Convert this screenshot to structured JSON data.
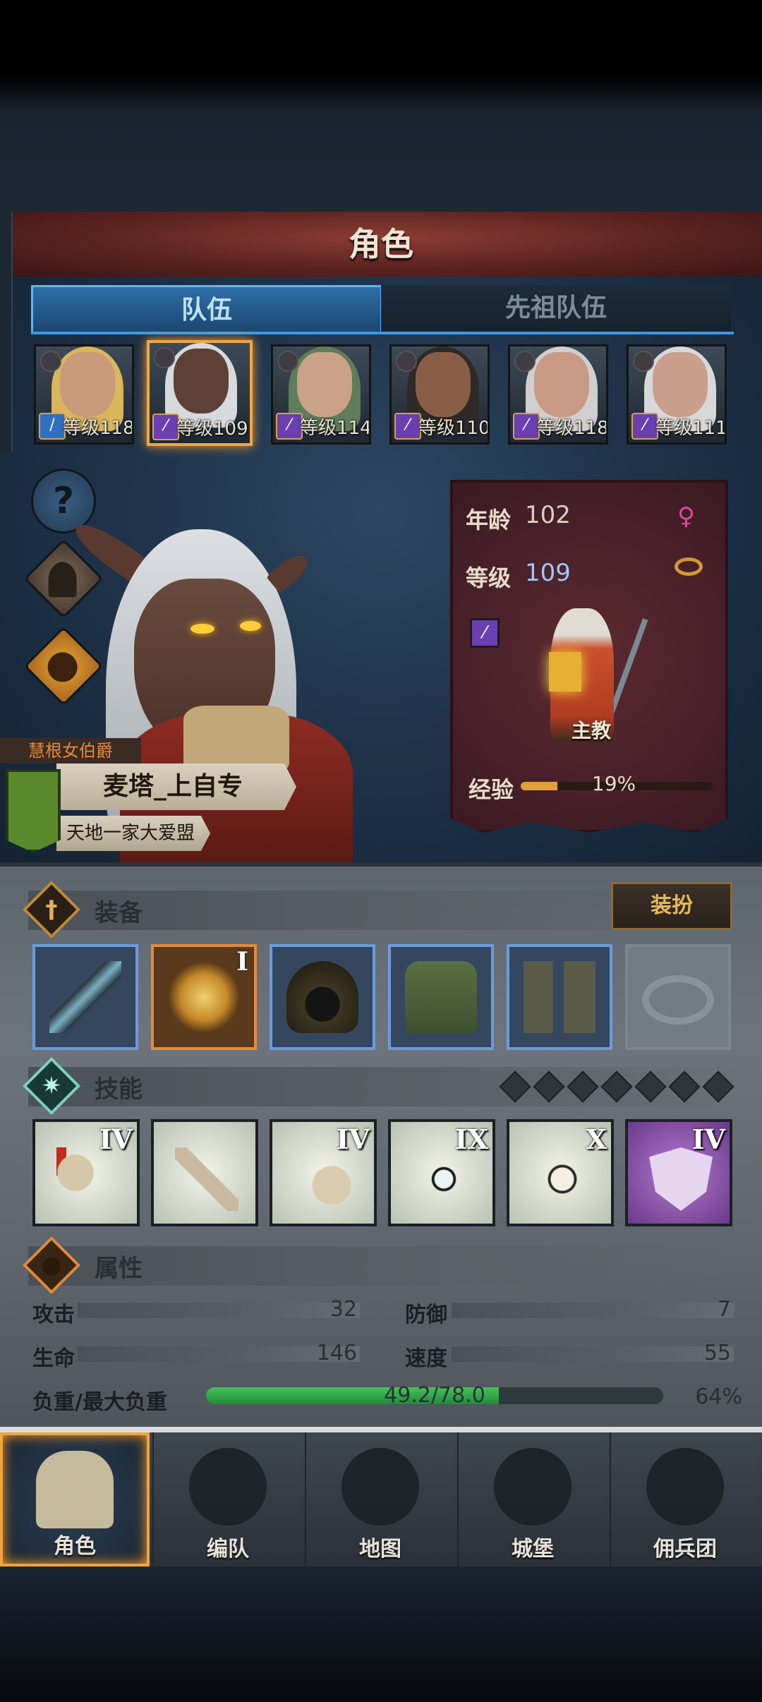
{
  "header": {
    "title": "角色"
  },
  "tabs": [
    {
      "label": "队伍",
      "active": true
    },
    {
      "label": "先祖队伍",
      "active": false
    }
  ],
  "party": [
    {
      "level_text": "等级118",
      "hair": "#d9b65a",
      "skin": "#c99a7a",
      "class_icon": "sword-icon"
    },
    {
      "level_text": "等级109",
      "hair": "#d7dadd",
      "skin": "#5e4036",
      "class_icon": "staff-icon",
      "selected": true
    },
    {
      "level_text": "等级114",
      "hair": "#5f7d5a",
      "skin": "#caa288",
      "class_icon": "staff-icon"
    },
    {
      "level_text": "等级110",
      "hair": "#2e2a28",
      "skin": "#8a5e46",
      "class_icon": "staff-icon"
    },
    {
      "level_text": "等级118",
      "hair": "#cfcfcf",
      "skin": "#c89a86",
      "class_icon": "staff-icon"
    },
    {
      "level_text": "等级111",
      "hair": "#d8d8d8",
      "skin": "#c99e8a",
      "class_icon": "staff-icon"
    }
  ],
  "side_buttons": [
    {
      "icon": "help-icon",
      "glyph": "?"
    },
    {
      "icon": "character-icon",
      "glyph": ""
    },
    {
      "icon": "potion-icon",
      "glyph": ""
    }
  ],
  "character": {
    "title_badge": "慧根女伯爵",
    "name": "麦塔_上自专",
    "guild": "天地一家大爱盟"
  },
  "info": {
    "age_label": "年龄",
    "age_value": "102",
    "level_label": "等级",
    "level_value": "109",
    "class_name": "主教",
    "exp_label": "经验",
    "exp_percent": "19%",
    "exp_fraction": 0.19
  },
  "sections": {
    "equipment": "装备",
    "skills": "技能",
    "attributes": "属性",
    "outfit_button": "装扮"
  },
  "equipment": [
    {
      "name": "staff-item",
      "style": "blue"
    },
    {
      "name": "tome-item",
      "style": "orange",
      "rank": "I"
    },
    {
      "name": "hood-item",
      "style": "blue"
    },
    {
      "name": "tunic-item",
      "style": "blue"
    },
    {
      "name": "boots-item",
      "style": "blue"
    },
    {
      "name": "ring-slot-empty",
      "style": "empty"
    }
  ],
  "skill_pips": 7,
  "skills": [
    {
      "rank": "IV",
      "style": "light"
    },
    {
      "rank": "",
      "style": "light"
    },
    {
      "rank": "IV",
      "style": "light"
    },
    {
      "rank": "IX",
      "style": "light"
    },
    {
      "rank": "X",
      "style": "light"
    },
    {
      "rank": "IV",
      "style": "purple"
    }
  ],
  "stats": {
    "attack_label": "攻击",
    "attack_value": "32",
    "defense_label": "防御",
    "defense_value": "7",
    "hp_label": "生命",
    "hp_value": "146",
    "speed_label": "速度",
    "speed_value": "55",
    "load_label": "负重/最大负重",
    "load_value": "49.2/78.0",
    "load_percent": "64%",
    "load_fraction": 0.64
  },
  "nav": [
    {
      "label": "角色",
      "active": true
    },
    {
      "label": "编队",
      "active": false
    },
    {
      "label": "地图",
      "active": false
    },
    {
      "label": "城堡",
      "active": false
    },
    {
      "label": "佣兵团",
      "active": false
    }
  ],
  "colors": {
    "accent": "#f0a43a",
    "tab_blue": "#3f98e3",
    "exp": "#e0a13a",
    "load": "#2fae48"
  }
}
